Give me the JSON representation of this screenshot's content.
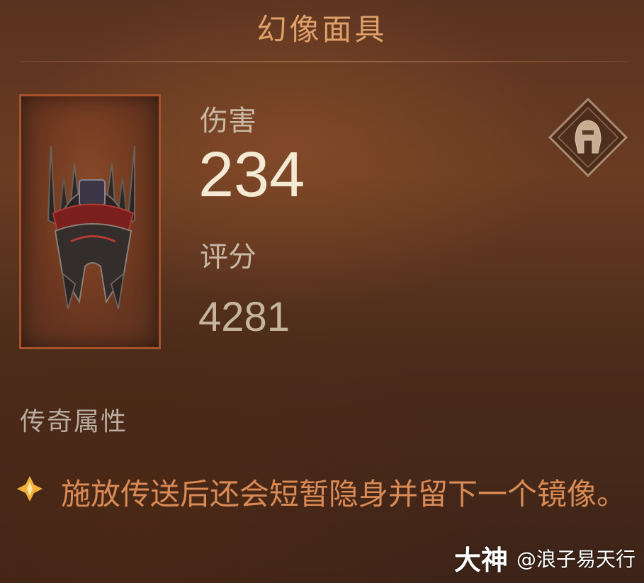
{
  "item": {
    "name": "幻像面具",
    "icon": "helmet-mask-icon"
  },
  "stats": {
    "damage_label": "伤害",
    "damage_value": "234",
    "score_label": "评分",
    "score_value": "4281"
  },
  "class_badge_icon": "spartan-helmet-icon",
  "legendary": {
    "section_title": "传奇属性",
    "bullet_icon": "legendary-diamond-icon",
    "affix": "施放传送后还会短暂隐身并留下一个镜像。"
  },
  "watermark": {
    "brand": "大神",
    "user": "@浪子易天行"
  },
  "colors": {
    "title": "#e0a06a",
    "affix": "#d98a55",
    "frame_border": "#a8522c",
    "value": "#f4ead4"
  }
}
